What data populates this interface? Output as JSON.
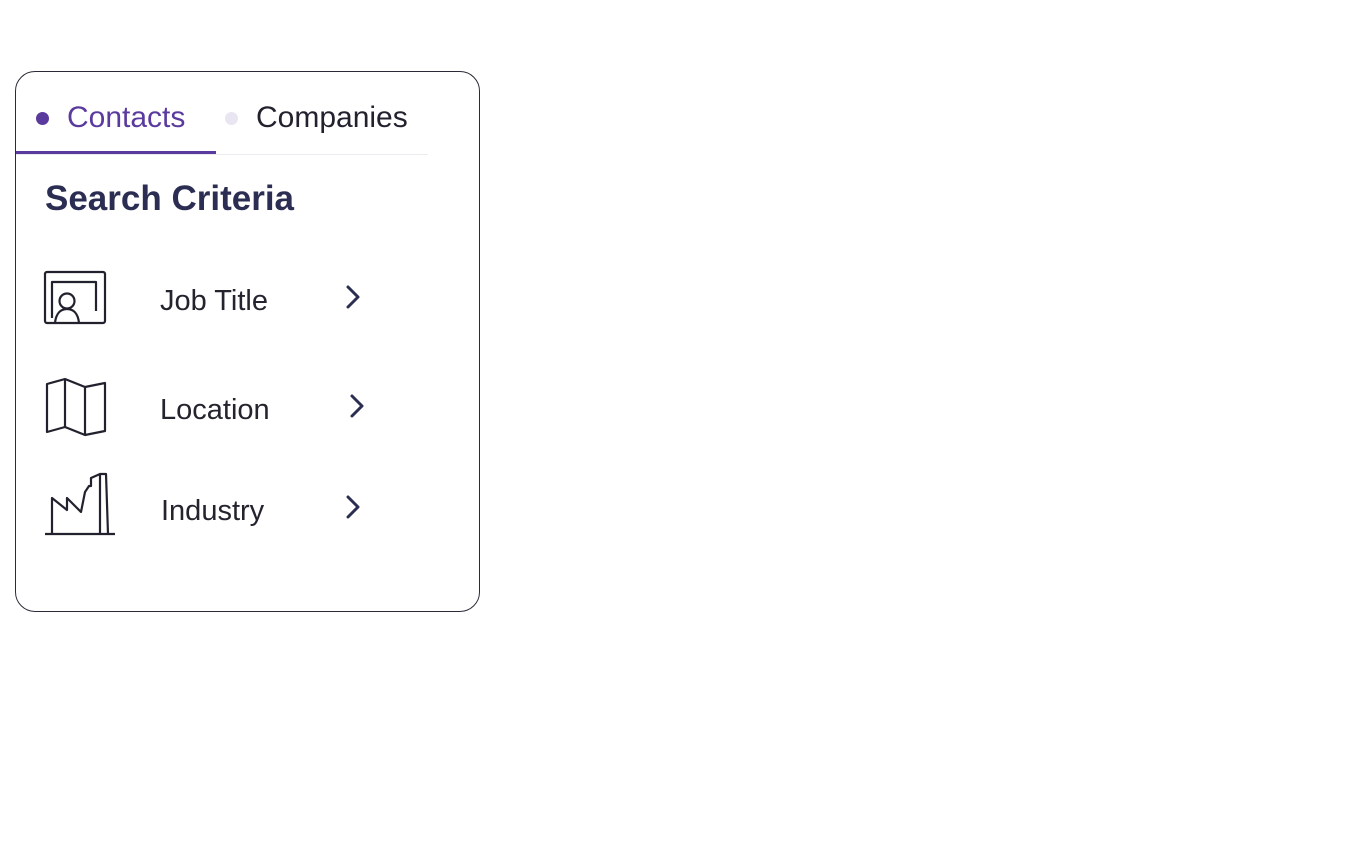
{
  "tabs": [
    {
      "label": "Contacts",
      "active": true
    },
    {
      "label": "Companies",
      "active": false
    }
  ],
  "panel": {
    "title": "Search Criteria"
  },
  "criteria": [
    {
      "label": "Job Title",
      "icon": "id-badge-icon"
    },
    {
      "label": "Location",
      "icon": "map-icon"
    },
    {
      "label": "Industry",
      "icon": "factory-icon"
    }
  ],
  "colors": {
    "accent": "#5b3a9e",
    "title": "#2b2e52",
    "text": "#24242e",
    "border": "#2b2b38"
  }
}
